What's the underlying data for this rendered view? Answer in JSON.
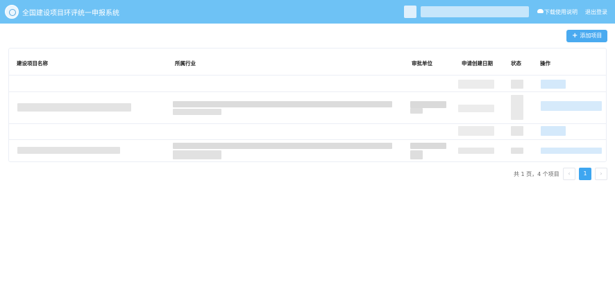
{
  "header": {
    "title": "全国建设项目环评统一申报系统",
    "download_label": "下载使用说明",
    "logout_label": "退出登录"
  },
  "toolbar": {
    "add_label": "添加项目"
  },
  "table": {
    "columns": [
      "建设项目名称",
      "所属行业",
      "审批单位",
      "申请创建日期",
      "状态",
      "操作"
    ]
  },
  "pagination": {
    "info": "共 1 页，4 个项目",
    "prev": "‹",
    "current": "1",
    "next": "›"
  },
  "colors": {
    "header_bg": "#6ec2f5",
    "primary": "#4aaaf0"
  }
}
